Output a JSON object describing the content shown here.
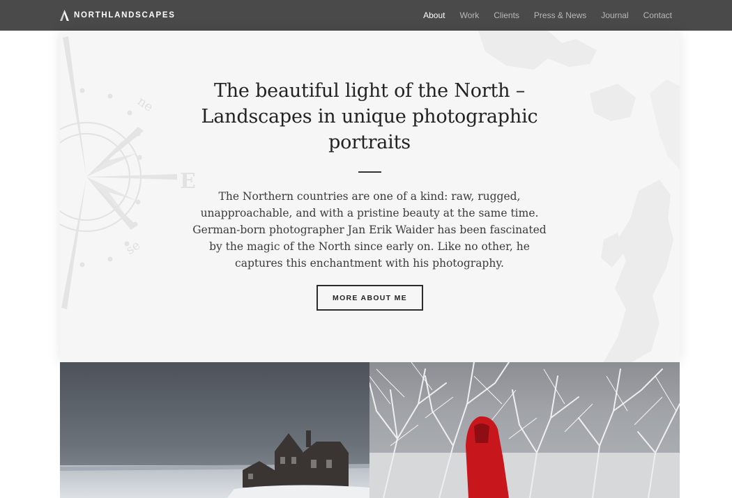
{
  "brand": {
    "name": "NORTHLANDSCAPES",
    "logo_icon": "mountain-peak-icon"
  },
  "nav": {
    "items": [
      {
        "label": "About",
        "active": true
      },
      {
        "label": "Work",
        "active": false
      },
      {
        "label": "Clients",
        "active": false
      },
      {
        "label": "Press & News",
        "active": false
      },
      {
        "label": "Journal",
        "active": false
      },
      {
        "label": "Contact",
        "active": false
      }
    ]
  },
  "hero": {
    "title": "The beautiful light of the North – Landscapes in unique photographic portraits",
    "text": "The Northern countries are one of a kind: raw, rugged, unapproachable, and with a pristine beauty at the same time. German-born photographer Jan Erik Waider has been fascinated by the magic of the North since early on. Like no other, he captures this enchantment with his photography.",
    "cta_label": "MORE ABOUT ME",
    "compass_labels": {
      "ne": "ne",
      "e": "E",
      "se": "se"
    }
  },
  "photos": [
    {
      "subject": "abandoned-farmhouse-in-snow"
    },
    {
      "subject": "person-in-red-jacket-among-frosted-trees"
    }
  ],
  "colors": {
    "nav_bg": "#4a4a4a",
    "nav_active": "#ffffff",
    "nav_inactive": "#b8b8b8",
    "hero_bg": "#f6f6f6",
    "text": "#222222",
    "jacket_red": "#c8161d"
  }
}
